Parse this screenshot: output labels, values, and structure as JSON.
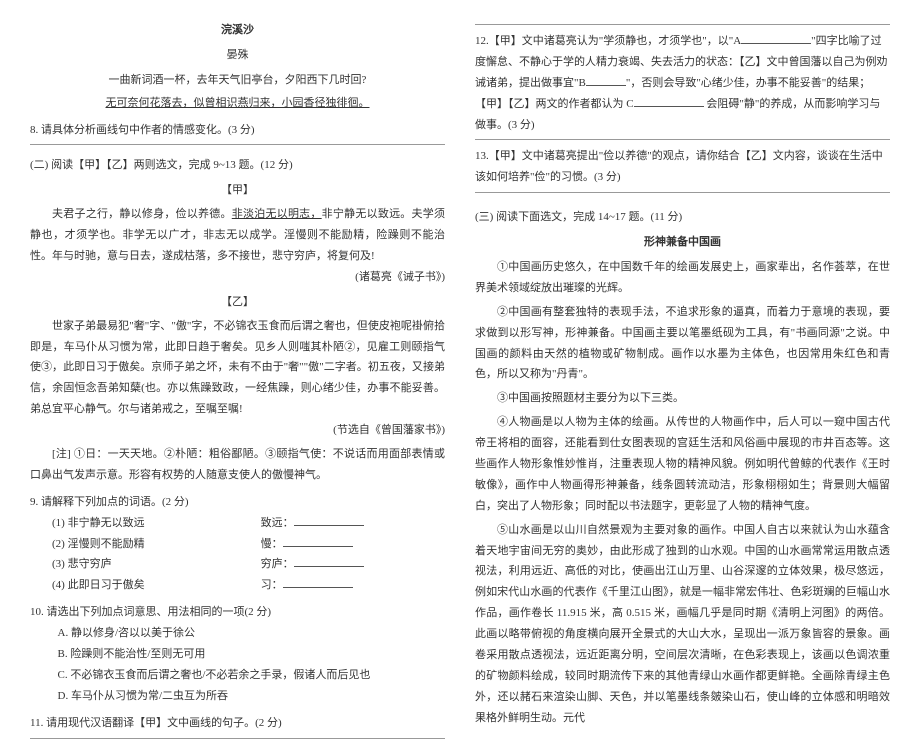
{
  "left": {
    "poem_title": "浣溪沙",
    "poem_author": "晏殊",
    "poem_line1": "一曲新词酒一杯，去年天气旧亭台，夕阳西下几时回?",
    "poem_line2_u": "无可奈何花落去，似曾相识燕归来，小园香径独徘徊。",
    "q8": "8. 请具体分析画线句中作者的情感变化。(3 分)",
    "section2": "(二) 阅读【甲】【乙】两则选文，完成 9~13 题。(12 分)",
    "label_jia": "【甲】",
    "jia_text_a": "夫君子之行，静以修身，俭以养德。",
    "jia_text_u": "非淡泊无以明志，",
    "jia_text_b": "非宁静无以致远。夫学须静也，才须学也。非学无以广才，非志无以成学。淫慢则不能励精，险躁则不能治性。年与时驰，意与日去，遂成枯落，多不接世，悲守穷庐，将复何及!",
    "jia_attr": "(诸葛亮《诫子书》)",
    "label_yi": "【乙】",
    "yi_p1": "世家子弟最易犯\"奢\"字、\"傲\"字，不必锦衣玉食而后谓之奢也，但使皮袍呢褂俯拾即是，车马仆从习惯为常，此即日趋于奢矣。见乡人则嗤其朴陋②，见雇工则颐指气使③，此即日习于傲矣。京师子弟之坏，未有不由于\"奢\"\"傲\"二字者。初五夜，又接弟信，余固恒念吾弟知蘖(也。亦以焦躁致政，一经焦躁，则心绪少佳，办事不能妥善。弟总宜平心静气。尔与诸弟戒之，至嘱至嘱!",
    "yi_attr": "(节选自《曾国藩家书》)",
    "notes": "[注] ①日：一天天地。②朴陋：粗俗鄙陋。③颐指气使：不说话而用面部表情或口鼻出气发声示意。形容有权势的人随意支使人的傲慢神气。",
    "q9": "9. 请解释下列加点的词语。(2 分)",
    "q9_1l": "(1) 非宁静无以致远",
    "q9_1r": "致远：",
    "q9_2l": "(2) 淫慢则不能励精",
    "q9_2r": "慢：",
    "q9_3l": "(3) 悲守穷庐",
    "q9_3r": "穷庐：",
    "q9_4l": "(4) 此即日习于傲矣",
    "q9_4r": "习：",
    "q10": "10. 请选出下列加点词意思、用法相同的一项(2 分)",
    "q10_a": "A. 静以修身/咨以以美于徐公",
    "q10_b": "B. 险躁则不能治性/至则无可用",
    "q10_c": "C. 不必锦衣玉食而后谓之奢也/不必若余之手录，假诸人而后见也",
    "q10_d": "D. 车马仆从习惯为常/二虫互为所吞",
    "q11": "11. 请用现代汉语翻译【甲】文中画线的句子。(2 分)"
  },
  "right": {
    "q12a": "12.【甲】文中诸葛亮认为\"学须静也，才须学也\"，以\"A",
    "q12b": "\"四字比喻了过度懈怠、不静心于学的人精力衰竭、失去活力的状态：【乙】文中曾国藩以自己为例劝诫诸弟，提出做事宜\"B",
    "q12c": "\"，否则会导致\"心绪少佳，办事不能妥善\"的结果；【甲】【乙】两文的作者都认为 C",
    "q12d": " 会阻碍\"静\"的养成，从而影响学习与做事。(3 分)",
    "q13": "13.【甲】文中诸葛亮提出\"俭以养德\"的观点，请你结合【乙】文内容，谈谈在生活中该如何培养\"俭\"的习惯。(3 分)",
    "section3": "(三) 阅读下面选文，完成 14~17 题。(11 分)",
    "essay_title": "形神兼备中国画",
    "p1": "①中国画历史悠久，在中国数千年的绘画发展史上，画家辈出，名作荟萃，在世界美术领域绽放出璀璨的光辉。",
    "p2": "②中国画有整套独特的表现手法，不追求形象的逼真，而着力于意境的表现，要求做到以形写神，形神兼备。中国画主要以笔墨纸砚为工具，有\"书画同源\"之说。中国画的颜料由天然的植物或矿物制成。画作以水墨为主体色，也因常用朱红色和青色，所以又称为\"丹青\"。",
    "p3": "③中国画按照题材主要分为以下三类。",
    "p4": "④人物画是以人物为主体的绘画。从传世的人物画作中，后人可以一窥中国古代帝王将相的面容，还能看到仕女图表现的宫廷生活和风俗画中展现的市井百态等。这些画作人物形象惟妙惟肖，注重表现人物的精神风貌。例如明代曾鲸的代表作《王时敏像》，画作中人物画得形神兼备，线条圆转流动洁，形象栩栩如生；背景则大幅留白，突出了人物形象；同时配以书法题字，更彰显了人物的精神气度。",
    "p5": "⑤山水画是以山川自然景观为主要对象的画作。中国人自古以来就认为山水蕴含着天地宇宙间无穷的奥妙，由此形成了独到的山水观。中国的山水画常常运用散点透视法，利用远近、高低的对比，使画出江山万里、山谷深邃的立体效果，极尽悠远，例如宋代山水画的代表作《千里江山图》，就是一幅非常宏伟壮、色彩斑斓的巨幅山水作品，画作卷长 11.915 米，高 0.515 米，画幅几乎是同时期《清明上河图》的两倍。此画以略带俯视的角度横向展开全景式的大山大水，呈现出一派万象皆容的景象。画卷采用散点透视法，远近距离分明，空间层次清晰，在色彩表现上，该画以色调浓重的矿物颜料绘成，较同时期流传下来的其他青绿山水画作都更鲜艳。全画除青绿主色外，还以赭石来渲染山脚、天色，并以笔墨线条皴染山石，使山峰的立体感和明暗效果格外鲜明生动。元代"
  }
}
